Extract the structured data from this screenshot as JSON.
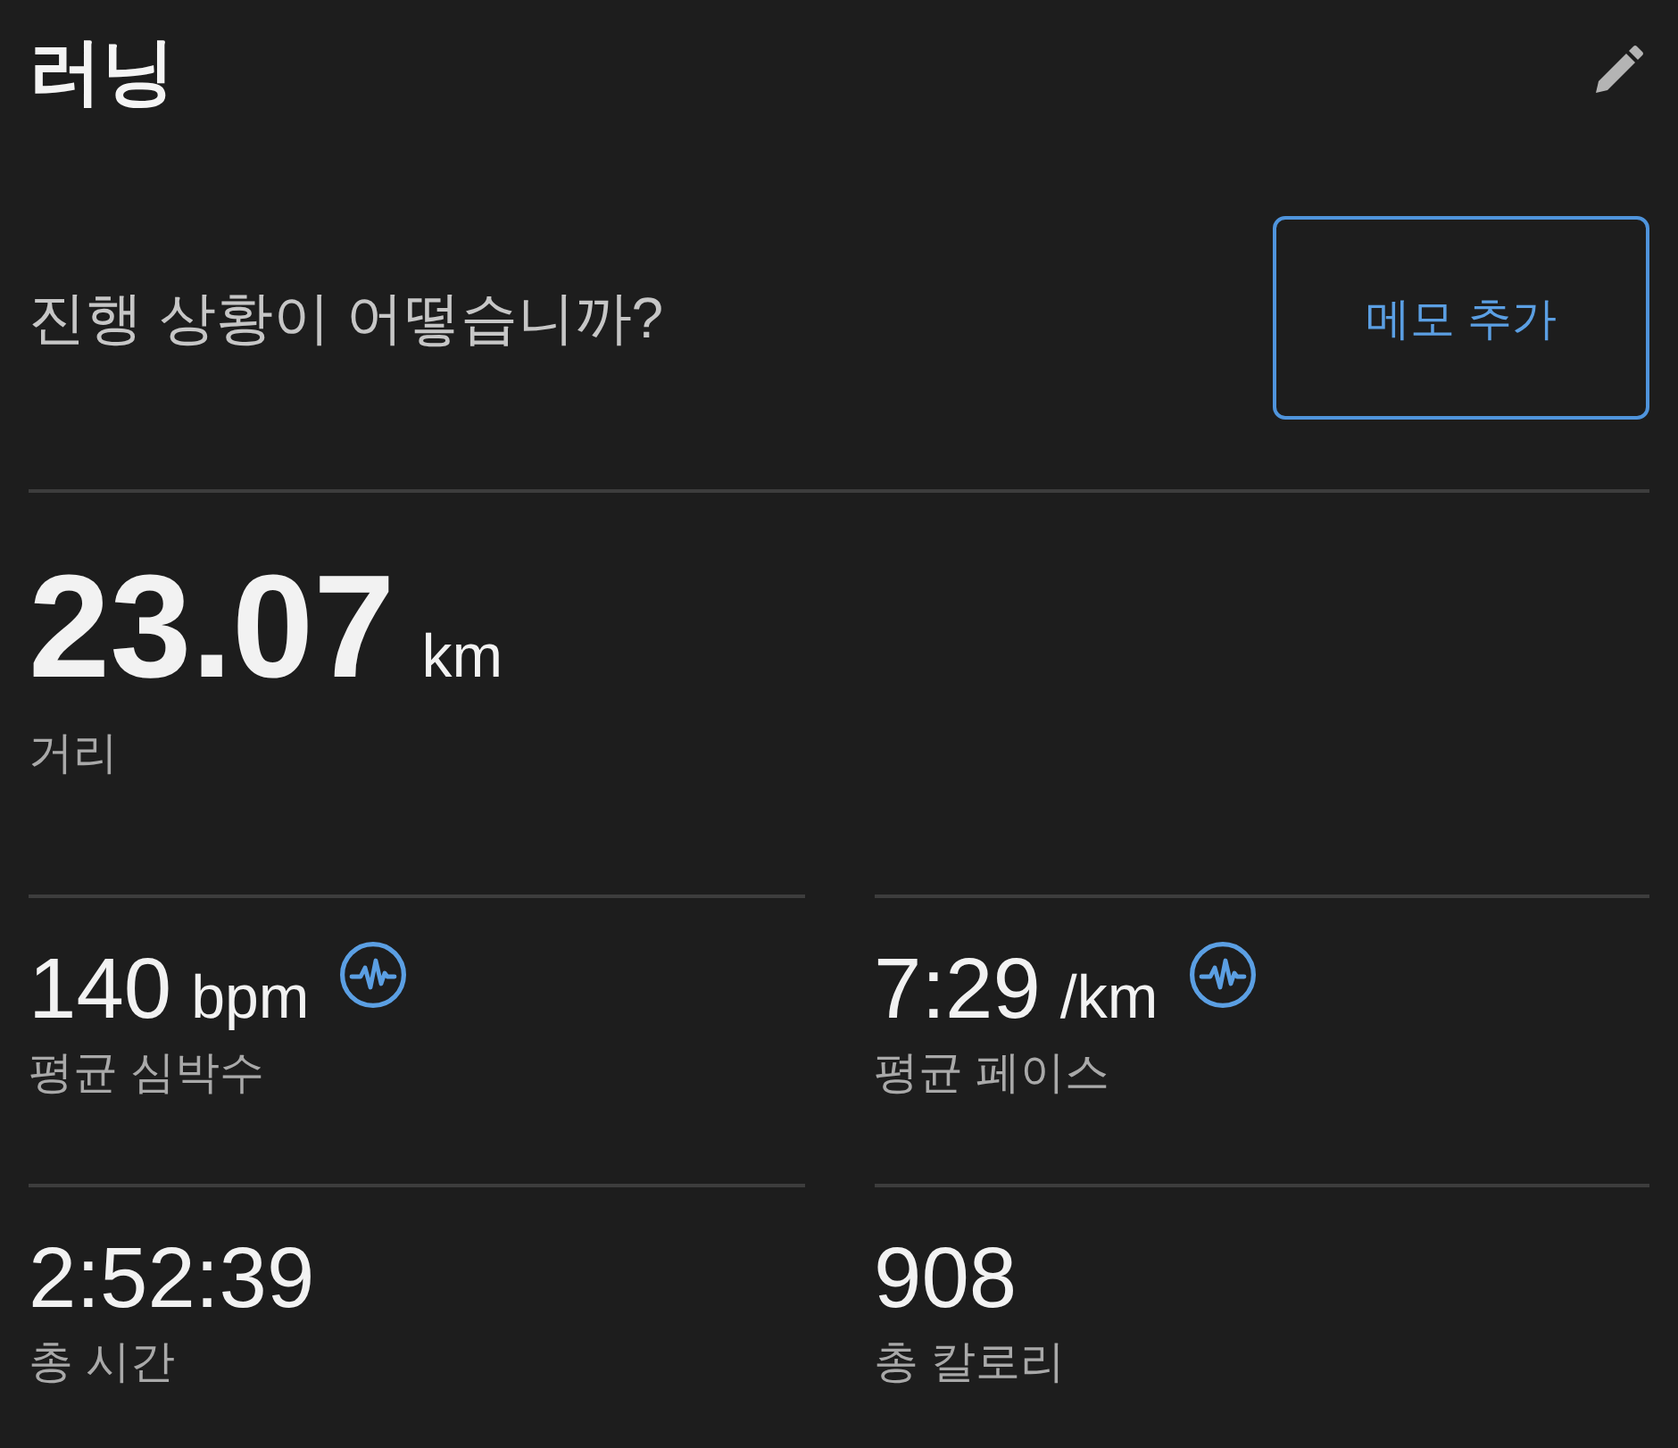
{
  "header": {
    "title": "러닝"
  },
  "note": {
    "prompt": "진행 상황이 어떻습니까?",
    "button": "메모 추가"
  },
  "distance": {
    "value": "23.07",
    "unit": "km",
    "label": "거리"
  },
  "stats": [
    {
      "value": "140",
      "unit": "bpm",
      "label": "평균 심박수",
      "graph_icon": true
    },
    {
      "value": "7:29",
      "unit": "/km",
      "label": "평균 페이스",
      "graph_icon": true
    },
    {
      "value": "2:52:39",
      "label": "총 시간",
      "graph_icon": false
    },
    {
      "value": "908",
      "label": "총 칼로리",
      "graph_icon": false
    }
  ]
}
